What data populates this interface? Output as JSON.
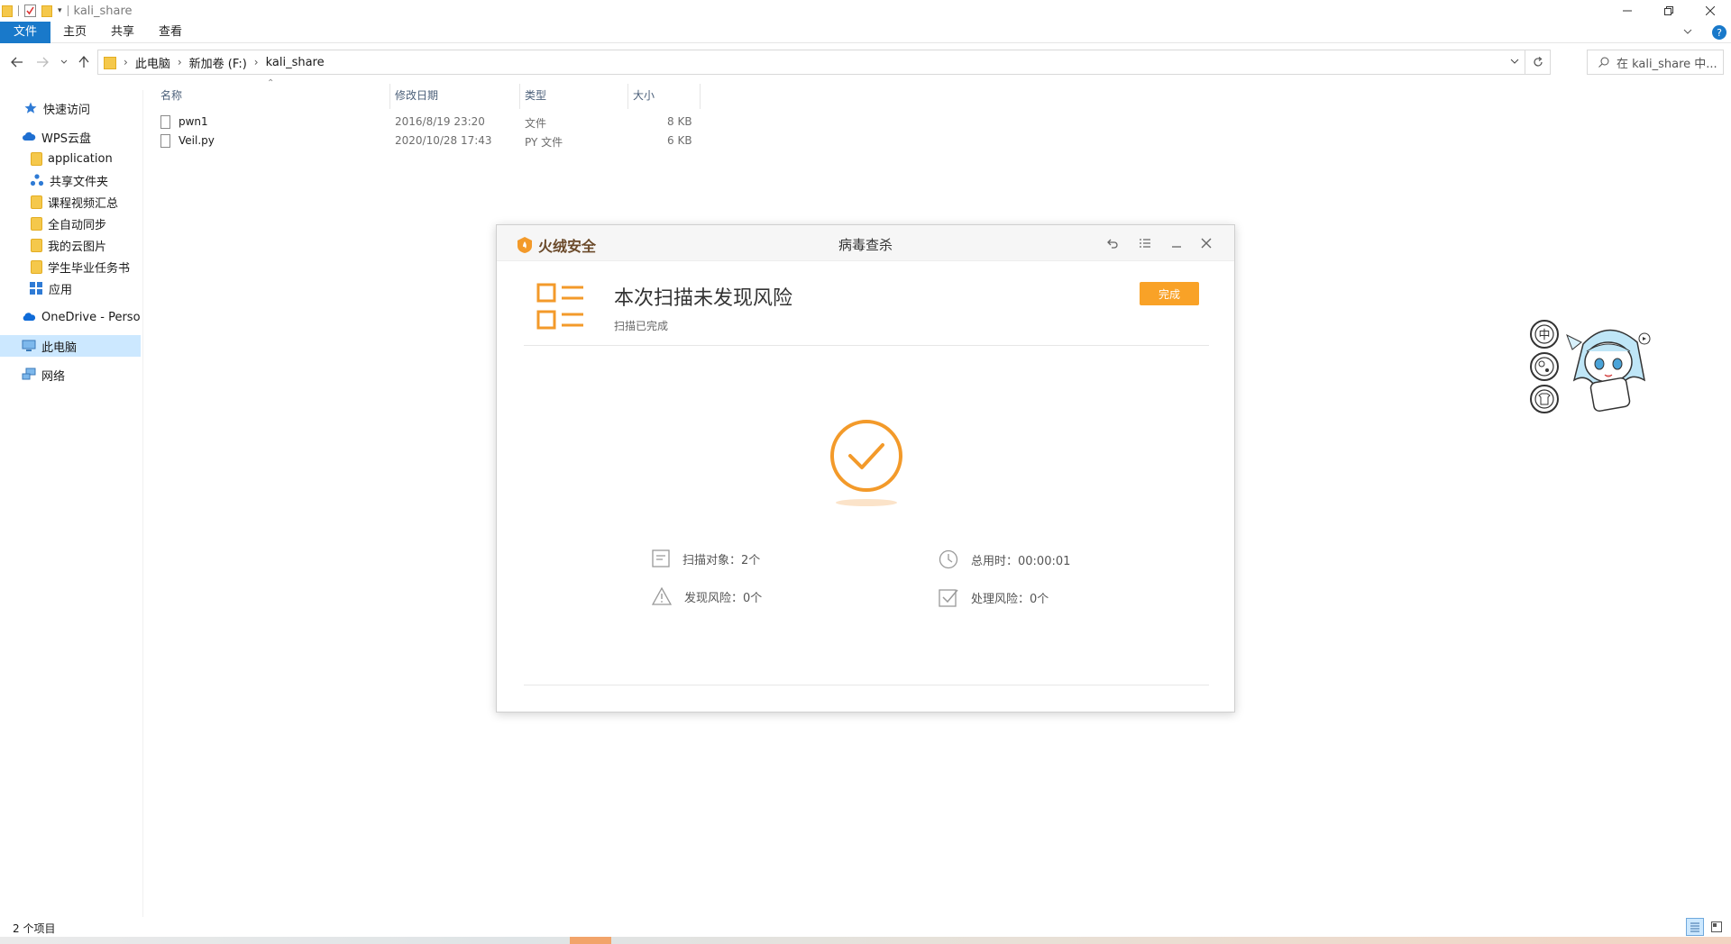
{
  "window": {
    "title": "kali_share"
  },
  "ribbon": {
    "tabs": [
      "文件",
      "主页",
      "共享",
      "查看"
    ]
  },
  "address": {
    "crumbs": [
      "此电脑",
      "新加卷 (F:)",
      "kali_share"
    ]
  },
  "search": {
    "placeholder": "在 kali_share 中..."
  },
  "sidebar": {
    "items": [
      {
        "label": "快速访问"
      },
      {
        "label": "WPS云盘"
      },
      {
        "label": "application"
      },
      {
        "label": "共享文件夹"
      },
      {
        "label": "课程视频汇总"
      },
      {
        "label": "全自动同步"
      },
      {
        "label": "我的云图片"
      },
      {
        "label": "学生毕业任务书"
      },
      {
        "label": "应用"
      },
      {
        "label": "OneDrive - Personal"
      },
      {
        "label": "此电脑"
      },
      {
        "label": "网络"
      }
    ]
  },
  "list": {
    "columns": [
      "名称",
      "修改日期",
      "类型",
      "大小"
    ],
    "rows": [
      {
        "name": "pwn1",
        "date": "2016/8/19 23:20",
        "type": "文件",
        "size": "8 KB"
      },
      {
        "name": "Veil.py",
        "date": "2020/10/28 17:43",
        "type": "PY 文件",
        "size": "6 KB"
      }
    ]
  },
  "status": {
    "count": "2 个项目"
  },
  "dialog": {
    "brand": "火绒安全",
    "title": "病毒查杀",
    "result_title": "本次扫描未发现风险",
    "result_sub": "扫描已完成",
    "done_label": "完成",
    "stats": {
      "scanned": "扫描对象：2个",
      "elapsed": "总用时：00:00:01",
      "risks": "发现风险：0个",
      "handled": "处理风险：0个"
    }
  },
  "colors": {
    "accent": "#f9a227",
    "ribbon_file": "#1979ca",
    "selection": "#cce8ff"
  }
}
